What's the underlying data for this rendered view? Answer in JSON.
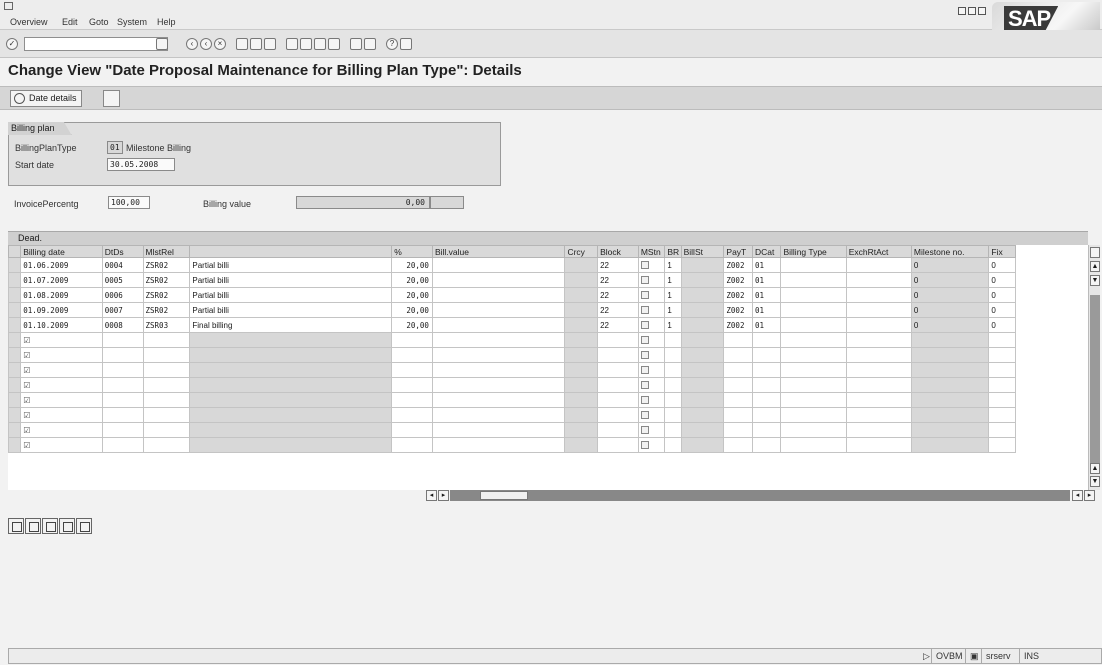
{
  "menubar": {
    "items": [
      "Overview",
      "Edit",
      "Goto",
      "System",
      "Help"
    ],
    "logo": "SAP"
  },
  "toolbar": {
    "command_field": ""
  },
  "page": {
    "title": "Change View \"Date Proposal Maintenance for Billing Plan Type\": Details"
  },
  "appbar": {
    "date_details_label": "Date details"
  },
  "billing_plan": {
    "group_title": "Billing plan",
    "type_label": "BillingPlanType",
    "type_code": "01",
    "type_name": "Milestone Billing",
    "start_label": "Start date",
    "start_value": "30.05.2008"
  },
  "invoice": {
    "percent_label": "InvoicePercentg",
    "percent_value": "100,00",
    "billing_value_label": "Billing value",
    "billing_value": "0,00"
  },
  "table": {
    "section_label": "Dead.",
    "columns": [
      "Billing date",
      "DtDs",
      "MlstRel",
      "",
      "%",
      "Bill.value",
      "Crcy",
      "Block",
      "MStn",
      "BR",
      "BillSt",
      "PayT",
      "DCat",
      "Billing Type",
      "ExchRtAct",
      "Milestone no.",
      "Fix"
    ],
    "rows": [
      {
        "date": "01.06.2009",
        "dtds": "0004",
        "mlst": "ZSR02",
        "desc": "Partial billi",
        "pct": "20,00",
        "block": "22",
        "br": "1",
        "payt": "Z002",
        "dcat": "01",
        "milestone": "0",
        "fix": "0"
      },
      {
        "date": "01.07.2009",
        "dtds": "0005",
        "mlst": "ZSR02",
        "desc": "Partial billi",
        "pct": "20,00",
        "block": "22",
        "br": "1",
        "payt": "Z002",
        "dcat": "01",
        "milestone": "0",
        "fix": "0"
      },
      {
        "date": "01.08.2009",
        "dtds": "0006",
        "mlst": "ZSR02",
        "desc": "Partial billi",
        "pct": "20,00",
        "block": "22",
        "br": "1",
        "payt": "Z002",
        "dcat": "01",
        "milestone": "0",
        "fix": "0"
      },
      {
        "date": "01.09.2009",
        "dtds": "0007",
        "mlst": "ZSR02",
        "desc": "Partial billi",
        "pct": "20,00",
        "block": "22",
        "br": "1",
        "payt": "Z002",
        "dcat": "01",
        "milestone": "0",
        "fix": "0"
      },
      {
        "date": "01.10.2009",
        "dtds": "0008",
        "mlst": "ZSR03",
        "desc": "Final billing",
        "pct": "20,00",
        "block": "22",
        "br": "1",
        "payt": "Z002",
        "dcat": "01",
        "milestone": "0",
        "fix": "0"
      }
    ],
    "empty_rows": 8
  },
  "statusbar": {
    "transaction": "OVBM",
    "server": "srserv",
    "mode": "INS"
  }
}
